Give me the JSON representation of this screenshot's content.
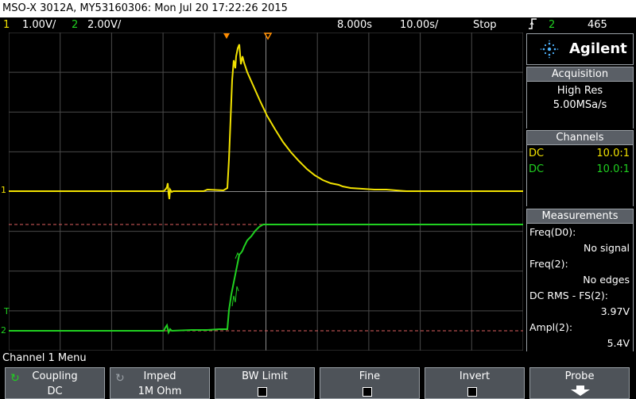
{
  "title": "MSO-X 3012A, MY53160306: Mon Jul 20 17:22:26 2015",
  "status": {
    "ch1_num": "1",
    "ch1_scale": "1.00V/",
    "ch2_num": "2",
    "ch2_scale": "2.00V/",
    "time_offset": "8.000s",
    "time_scale": "10.00s/",
    "run_state": "Stop",
    "trigger_icon": "rising-edge-icon",
    "trigger_source": "2",
    "trigger_level": "465"
  },
  "brand": {
    "name": "Agilent",
    "logo_icon": "spark-icon"
  },
  "acquisition": {
    "header": "Acquisition",
    "mode": "High Res",
    "rate": "5.00MSa/s"
  },
  "channels": {
    "header": "Channels",
    "rows": [
      {
        "coupling": "DC",
        "probe": "10.0:1"
      },
      {
        "coupling": "DC",
        "probe": "10.0:1"
      }
    ]
  },
  "measurements": {
    "header": "Measurements",
    "items": [
      {
        "label": "Freq(D0):",
        "value": "No signal"
      },
      {
        "label": "Freq(2):",
        "value": "No edges"
      },
      {
        "label": "DC RMS - FS(2):",
        "value": "3.97V"
      },
      {
        "label": "Ampl(2):",
        "value": "5.4V"
      }
    ]
  },
  "markers": {
    "ch1": "1",
    "ch2": "2",
    "trig": "T"
  },
  "menu": {
    "label": "Channel 1 Menu",
    "softkeys": [
      {
        "label": "Coupling",
        "value": "DC"
      },
      {
        "label": "Imped",
        "value": "1M Ohm"
      },
      {
        "label": "BW Limit",
        "value": ""
      },
      {
        "label": "Fine",
        "value": ""
      },
      {
        "label": "Invert",
        "value": ""
      },
      {
        "label": "Probe",
        "value": ""
      }
    ]
  },
  "colors": {
    "ch1": "#f2e200",
    "ch2": "#20d020",
    "grid": "#6a6a6a",
    "trigger_line": "#e06060",
    "trigger_marker": "#ff8c00"
  }
}
